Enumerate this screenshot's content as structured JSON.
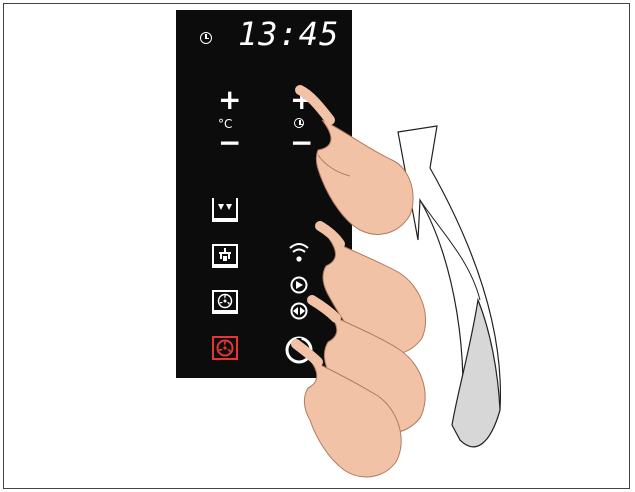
{
  "display": {
    "clock_icon": "clock-icon",
    "time": "13:45"
  },
  "controls": {
    "temperature_unit": "°C",
    "timer_icon": "clock-icon",
    "plus_symbol": "+",
    "minus_symbol": "−"
  },
  "modes": [
    {
      "icon": "top-heat-icon",
      "active": false
    },
    {
      "icon": "fan-top-heat-icon",
      "active": false
    },
    {
      "icon": "fan-bottom-heat-icon",
      "active": false
    },
    {
      "icon": "fan-ring-heat-icon",
      "active": true
    }
  ],
  "functions": [
    {
      "icon": "wireless-icon"
    },
    {
      "icon": "play-icon"
    },
    {
      "icon": "play-both-icon"
    },
    {
      "icon": "power-icon"
    }
  ],
  "colors": {
    "panel": "#0c0c0c",
    "active_mode": "#e53535",
    "skin": "#f2c2a7",
    "arrow_fill": "#d7d7d7"
  }
}
